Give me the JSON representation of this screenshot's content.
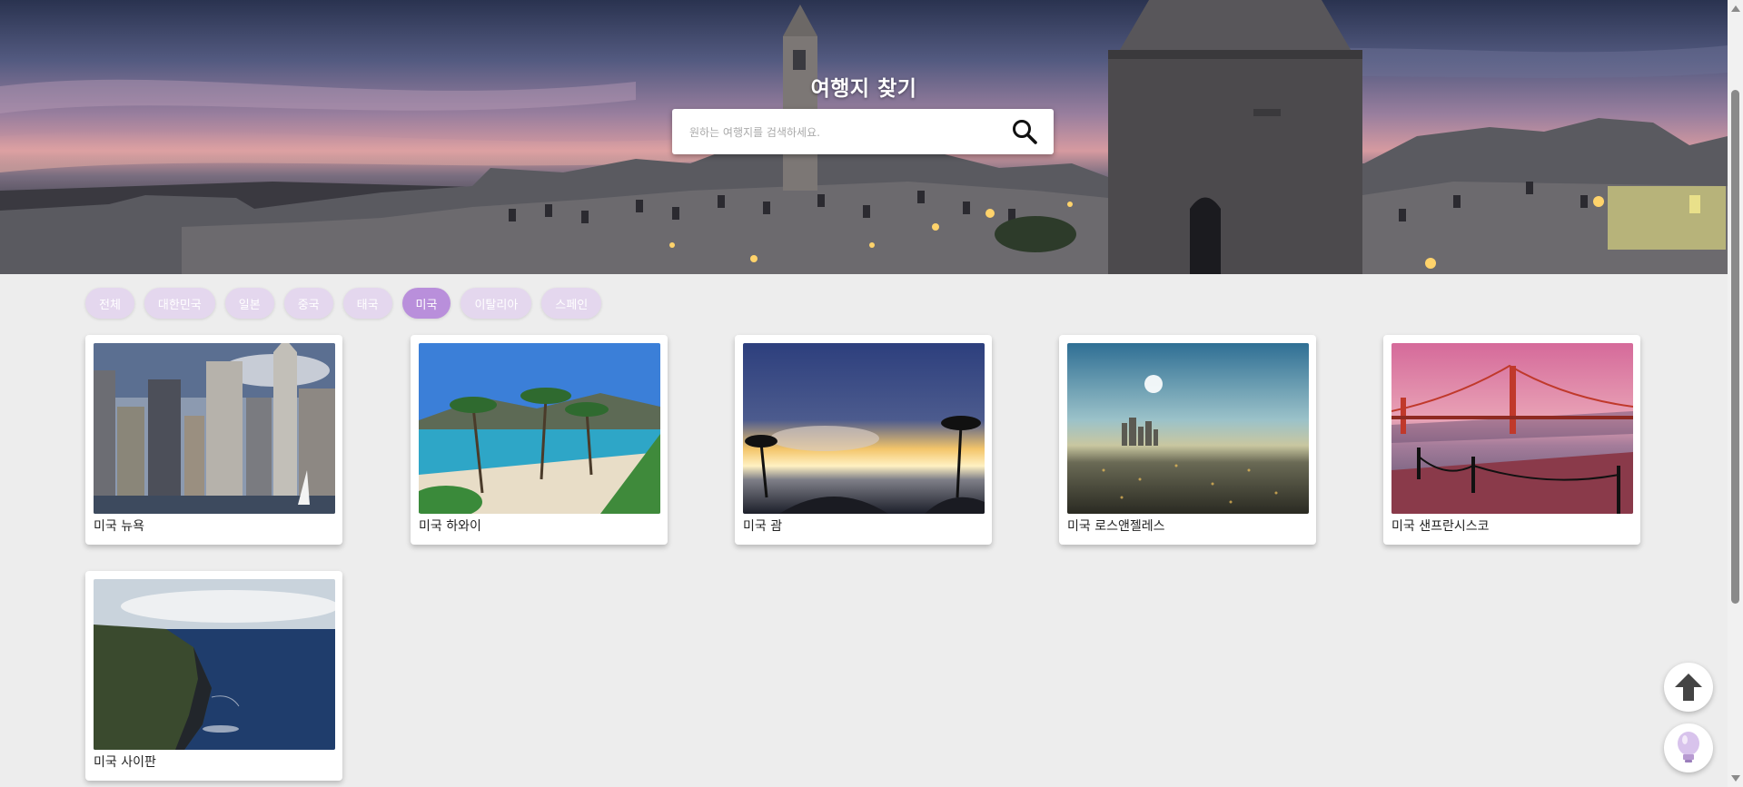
{
  "hero": {
    "title": "여행지 찾기",
    "search_placeholder": "원하는 여행지를 검색하세요.",
    "search_icon": "magnifier-icon"
  },
  "filters": {
    "items": [
      "전체",
      "대한민국",
      "일본",
      "중국",
      "태국",
      "미국",
      "이탈리아",
      "스페인"
    ],
    "active": "미국",
    "chip_color": "#e4d7ee",
    "active_color": "#b98fdb"
  },
  "cards": [
    {
      "caption": "미국 뉴욕"
    },
    {
      "caption": "미국 하와이"
    },
    {
      "caption": "미국 괌"
    },
    {
      "caption": "미국 로스앤젤레스"
    },
    {
      "caption": "미국 샌프란시스코"
    },
    {
      "caption": "미국 사이판"
    }
  ],
  "floating": {
    "top_icon": "arrow-up-icon",
    "lightbulb_icon": "lightbulb-icon"
  }
}
